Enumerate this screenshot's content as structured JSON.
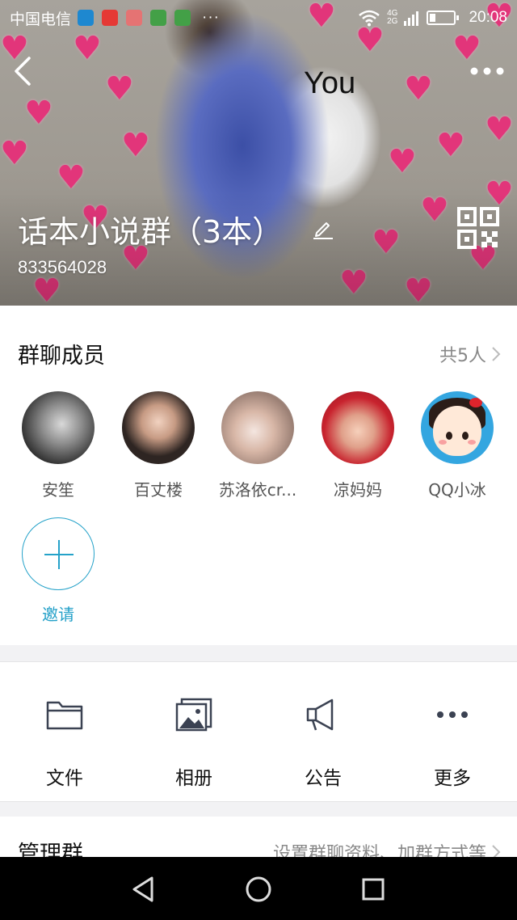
{
  "status_bar": {
    "carrier": "中国电信",
    "dots": "···",
    "net_top": "4G",
    "net_bottom": "2G",
    "time": "20:08",
    "notif_colors": [
      "#1e88d0",
      "#e53935",
      "#e57373",
      "#43a047",
      "#43a047"
    ]
  },
  "header": {
    "back_icon": "back-arrow-icon",
    "more_icon": "more-dots-icon",
    "sticker_text": "You",
    "group_name": "话本小说群（3本）",
    "group_id": "833564028",
    "edit_icon": "pencil-icon",
    "qr_icon": "qr-code-icon"
  },
  "members": {
    "title": "群聊成员",
    "count_label": "共5人",
    "list": [
      {
        "name": "安笙"
      },
      {
        "name": "百丈楼"
      },
      {
        "name": "苏洛依cr..."
      },
      {
        "name": "凉妈妈"
      },
      {
        "name": "QQ小冰"
      }
    ],
    "invite_label": "邀请"
  },
  "actions": [
    {
      "label": "文件",
      "icon": "folder-icon"
    },
    {
      "label": "相册",
      "icon": "album-icon"
    },
    {
      "label": "公告",
      "icon": "megaphone-icon"
    },
    {
      "label": "更多",
      "icon": "more-icon"
    }
  ],
  "manage": {
    "title": "管理群",
    "description": "设置群聊资料、加群方式等"
  },
  "colors": {
    "accent": "#25a2c9",
    "heart": "#e2357a",
    "nav_bg": "#000000"
  }
}
